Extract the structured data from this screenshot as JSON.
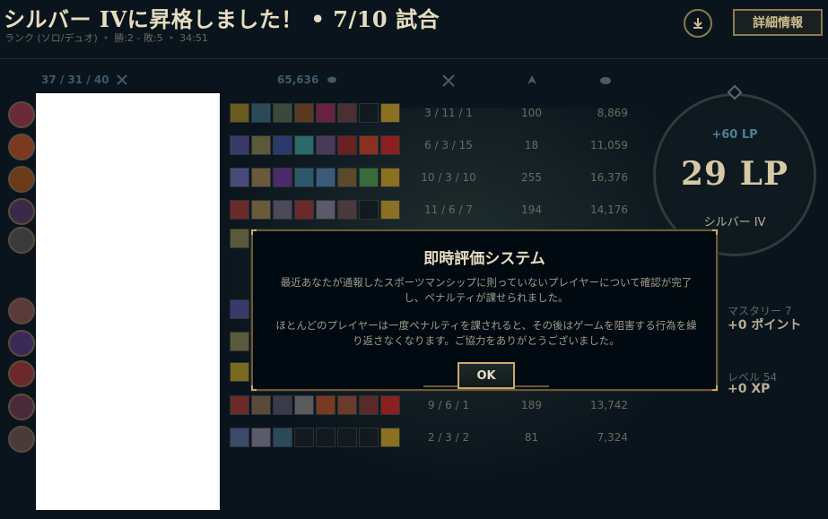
{
  "header": {
    "title": "シルバー IVに昇格しました！ • 7/10 試合",
    "queue": "ランク (ソロ/デュオ)",
    "record": "勝:2 - 敗:5",
    "duration": "34:51",
    "details_label": "詳細情報"
  },
  "team": {
    "kda_total": "37 / 31 / 40",
    "gold_total": "65,636"
  },
  "players": [
    {
      "kda": "3 / 11 / 1",
      "cs": "100",
      "gold": "8,869"
    },
    {
      "kda": "6 / 3 / 15",
      "cs": "18",
      "gold": "11,059"
    },
    {
      "kda": "10 / 3 / 10",
      "cs": "255",
      "gold": "16,376"
    },
    {
      "kda": "11 / 6 / 7",
      "cs": "194",
      "gold": "14,176"
    },
    {
      "kda": "",
      "cs": "",
      "gold": ""
    },
    {
      "kda": "",
      "cs": "",
      "gold": ""
    },
    {
      "kda": "",
      "cs": "",
      "gold": ""
    },
    {
      "kda": "",
      "cs": "",
      "gold": ""
    },
    {
      "kda": "9 / 6 / 1",
      "cs": "189",
      "gold": "13,742"
    },
    {
      "kda": "2 / 3 / 2",
      "cs": "81",
      "gold": "7,324"
    }
  ],
  "lp": {
    "gain": "+60 LP",
    "value": "29 LP",
    "rank": "シルバー IV"
  },
  "progress": {
    "mastery_label": "マスタリー 7",
    "mastery_value": "+0 ポイント",
    "level_label": "レベル 54",
    "level_value": "+0 XP"
  },
  "modal": {
    "title": "即時評価システム",
    "paragraph1": "最近あなたが通報したスポーツマンシップに則っていないプレイヤーについて確認が完了し、ペナルティが課せられました。",
    "paragraph2": "ほとんどのプレイヤーは一度ペナルティを課されると、その後はゲームを阻害する行為を繰り返さなくなります。ご協力をありがとうございました。",
    "ok_label": "OK"
  },
  "colors": {
    "accent_gold": "#c8aa6e",
    "background": "#0a141c",
    "lp_blue": "#4e7f95"
  },
  "icons": [
    "download-icon",
    "crossed-swords-icon",
    "gold-coin-icon",
    "minion-icon"
  ]
}
